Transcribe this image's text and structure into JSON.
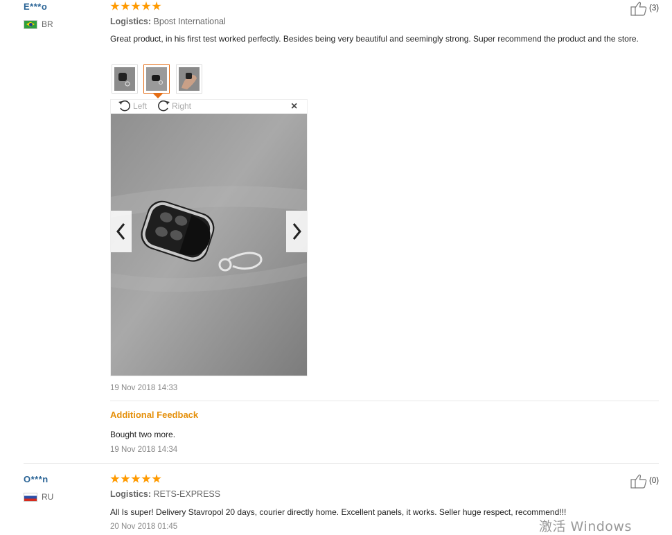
{
  "reviews": [
    {
      "user": "E***o",
      "country": "BR",
      "stars": 5,
      "logistics_label": "Logistics:",
      "logistics_value": "Bpost International",
      "text": "Great product, in his first test worked perfectly. Besides being very beautiful and seemingly strong. Super recommend the product and the store.",
      "likes": "(3)",
      "date": "19 Nov 2018 14:33",
      "viewer": {
        "rotate_left": "Left",
        "rotate_right": "Right",
        "close": "×"
      },
      "additional_title": "Additional Feedback",
      "additional_text": "Bought two more.",
      "additional_date": "19 Nov 2018 14:34"
    },
    {
      "user": "O***n",
      "country": "RU",
      "stars": 5,
      "logistics_label": "Logistics:",
      "logistics_value": "RETS-EXPRESS",
      "text": "All Is super! Delivery Stavropol 20 days, courier directly home. Excellent panels, it works. Seller huge respect, recommend!!!",
      "likes": "(0)",
      "date": "20 Nov 2018 01:45"
    }
  ],
  "watermark": "激活 Windows",
  "colors": {
    "accent": "#ff9a00",
    "link": "#2a6496",
    "highlight": "#e5900b"
  }
}
